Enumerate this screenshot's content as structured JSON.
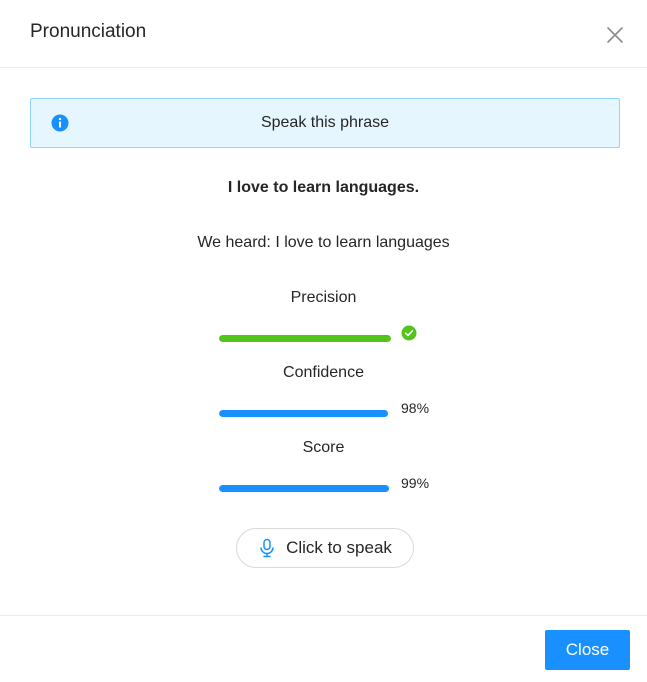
{
  "dialog": {
    "title": "Pronunciation",
    "close_icon": "close-icon"
  },
  "alert": {
    "icon": "info-icon",
    "text": "Speak this phrase",
    "background": "#e6f6fe",
    "border": "#91d5ff",
    "icon_color": "#1890ff"
  },
  "phrase": "I love to learn languages.",
  "heard": "We heard: I love to learn languages",
  "metrics": [
    {
      "label": "Precision",
      "progress_percent": 100,
      "value_text": "",
      "status": "success",
      "status_icon": "check-circle-icon",
      "color": "#52c41a"
    },
    {
      "label": "Confidence",
      "progress_percent": 98,
      "value_text": "98%",
      "color": "#1890ff"
    },
    {
      "label": "Score",
      "progress_percent": 99,
      "value_text": "99%",
      "color": "#1890ff"
    }
  ],
  "speak_button": {
    "icon": "microphone-icon",
    "label": "Click to speak"
  },
  "footer": {
    "close_label": "Close",
    "primary_color": "#1890ff"
  }
}
